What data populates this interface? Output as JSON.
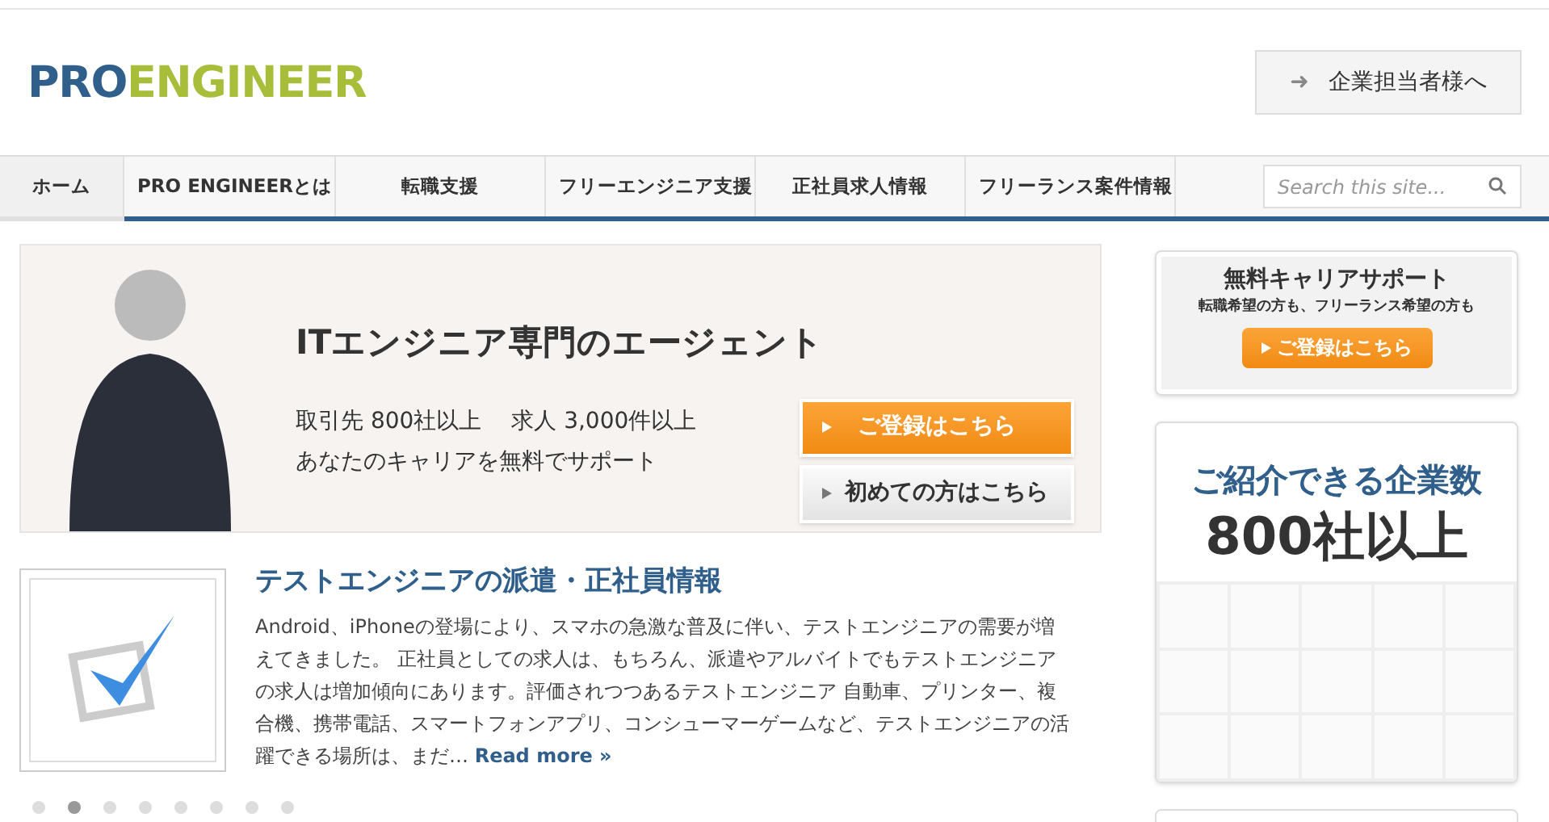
{
  "header": {
    "logo": {
      "part_1": "PRO",
      "part_2": "ENGINEER"
    },
    "employer_button": {
      "icon": "➜",
      "label": "企業担当者様へ"
    }
  },
  "nav": {
    "tabs": [
      {
        "label": "ホーム",
        "selected": true
      },
      {
        "label": "PRO ENGINEERとは",
        "selected": false
      },
      {
        "label": "転職支援",
        "selected": false
      },
      {
        "label": "フリーエンジニア支援",
        "selected": false
      },
      {
        "label": "正社員求人情報",
        "selected": false
      },
      {
        "label": "フリーランス案件情報",
        "selected": false
      }
    ],
    "search": {
      "placeholder": "Search this site..."
    }
  },
  "hero": {
    "title": "ITエンジニア専門のエージェント",
    "stats": "取引先 800社以上　 求人 3,000件以上",
    "subtitle": "あなたのキャリアを無料でサポート",
    "buttons": [
      {
        "kind": "primary",
        "label": "ご登録はこちら"
      },
      {
        "kind": "secondary",
        "label": "初めての方はこちら"
      }
    ]
  },
  "article": {
    "title": "テストエンジニアの派遣・正社員情報",
    "body": "Android、iPhoneの登場により、スマホの急激な普及に伴い、テストエンジニアの需要が増えてきました。 正社員としての求人は、もちろん、派遣やアルバイトでもテストエンジニアの求人は増加傾向にあります。評価されつつあるテストエンジニア 自動車、プリンター、複合機、携帯電話、スマートフォンアプリ、コンシューマーゲームなど、テストエンジニアの活躍できる場所は、まだ…",
    "read_more": "Read more »"
  },
  "slider_dots": [
    {
      "selected": false
    },
    {
      "selected": true
    },
    {
      "selected": false
    },
    {
      "selected": false
    },
    {
      "selected": false
    },
    {
      "selected": false
    },
    {
      "selected": false
    },
    {
      "selected": false
    }
  ],
  "sidebar": {
    "career_support": {
      "title": "無料キャリアサポート",
      "subtitle": "転職希望の方も、フリーランス希望の方も",
      "button": "ご登録はこちら"
    },
    "companies": {
      "title": "ご紹介できる企業数",
      "count": "800社以上"
    }
  }
}
